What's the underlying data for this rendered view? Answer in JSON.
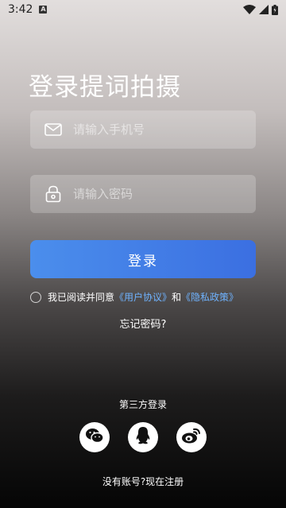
{
  "status_bar": {
    "time": "3:42",
    "indicator": "A",
    "icons": [
      "wifi-icon",
      "signal-icon",
      "battery-icon"
    ]
  },
  "title": "登录提词拍摄",
  "fields": {
    "phone": {
      "placeholder": "请输入手机号",
      "icon": "mail-icon"
    },
    "password": {
      "placeholder": "请输入密码",
      "icon": "lock-icon"
    }
  },
  "login_button": "登录",
  "agreement": {
    "prefix": "我已阅读并同意",
    "user_agreement": "《用户协议》",
    "conjunction": "和",
    "privacy_policy": "《隐私政策》"
  },
  "forgot_password": "忘记密码?",
  "third_party": {
    "title": "第三方登录",
    "providers": [
      "wechat-icon",
      "qq-icon",
      "weibo-icon"
    ]
  },
  "register": "没有账号?现在注册",
  "colors": {
    "button_start": "#4b8eec",
    "button_end": "#3b6fe1",
    "link": "#6fb3ff"
  }
}
